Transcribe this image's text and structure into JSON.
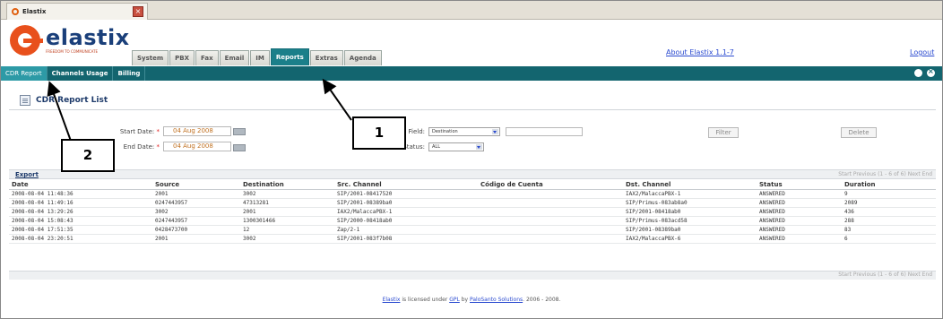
{
  "browser": {
    "tab_title": "Elastix"
  },
  "header": {
    "logo_name": "elastix",
    "logo_tagline": "FREEDOM TO COMMUNICATE",
    "menu": [
      "System",
      "PBX",
      "Fax",
      "Email",
      "IM",
      "Reports",
      "Extras",
      "Agenda"
    ],
    "active_menu": "Reports",
    "about_link": "About Elastix 1.1-7",
    "logout_link": "Logout"
  },
  "subnav": {
    "items": [
      "CDR Report",
      "Channels Usage",
      "Billing"
    ],
    "active": "CDR Report"
  },
  "page": {
    "title": "CDR Report List"
  },
  "filter": {
    "start_date_label": "Start Date:",
    "start_date_value": "04 Aug 2008",
    "end_date_label": "End Date:",
    "end_date_value": "04 Aug 2008",
    "required_mark": "*",
    "field_label": "Field:",
    "field_value": "Destination",
    "status_label": "Status:",
    "status_value": "ALL",
    "filter_button": "Filter",
    "delete_button": "Delete"
  },
  "table": {
    "export_label": "Export",
    "pager_text": "Start  Previous (1 - 6 of 6) Next  End",
    "columns": [
      "Date",
      "Source",
      "Destination",
      "Src. Channel",
      "Código de Cuenta",
      "Dst. Channel",
      "Status",
      "Duration"
    ],
    "rows": [
      [
        "2008-08-04 11:48:36",
        "2001",
        "3002",
        "SIP/2001-08417520",
        "",
        "IAX2/MalaccaPBX-1",
        "ANSWERED",
        "9"
      ],
      [
        "2008-08-04 11:49:16",
        "0247443957",
        "47313281",
        "SIP/2001-08389ba0",
        "",
        "SIP/Primus-083ab8a0",
        "ANSWERED",
        "2089"
      ],
      [
        "2008-08-04 13:29:26",
        "3002",
        "2001",
        "IAX2/MalaccaPBX-1",
        "",
        "SIP/2001-08418ab0",
        "ANSWERED",
        "436"
      ],
      [
        "2008-08-04 15:08:43",
        "0247443957",
        "1300301466",
        "SIP/2000-08418ab0",
        "",
        "SIP/Primus-083acd58",
        "ANSWERED",
        "288"
      ],
      [
        "2008-08-04 17:51:35",
        "0428473700",
        "12",
        "Zap/2-1",
        "",
        "SIP/2001-08389ba0",
        "ANSWERED",
        "83"
      ],
      [
        "2008-08-04 23:20:51",
        "2001",
        "3002",
        "SIP/2001-083f7b08",
        "",
        "IAX2/MalaccaPBX-6",
        "ANSWERED",
        "6"
      ]
    ]
  },
  "footer": {
    "brand": "Elastix",
    "text1": " is licensed under ",
    "license": "GPL",
    "text2": " by ",
    "company": "PaloSanto Solutions",
    "text3": ". 2006 - 2008."
  },
  "callouts": {
    "one": "1",
    "two": "2"
  },
  "colors": {
    "nav_teal": "#13656f",
    "active_tab": "#1b7f8a",
    "logo_orange": "#e8501c",
    "logo_blue": "#1a3f7a",
    "link_blue": "#2a4ad0"
  }
}
